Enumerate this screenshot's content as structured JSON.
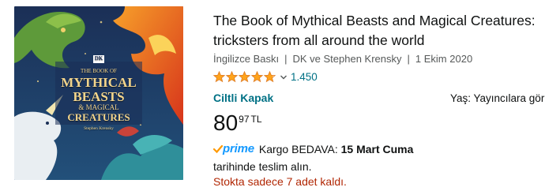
{
  "product": {
    "title_line1": "The Book of Mythical Beasts and Magical Creatures:",
    "title_line2": "tricksters from all around the world",
    "edition": "İngilizce Baskı",
    "authors": "DK ve Stephen Krensky",
    "date": "1 Ekim 2020",
    "rating_stars": 4.8,
    "rating_count": "1.450",
    "format": "Ciltli Kapak",
    "publisher_note": "Yaş: Yayıncılara gör",
    "price_whole": "80",
    "price_fraction": "97",
    "currency": "TL",
    "prime_label": "prime",
    "shipping_prefix": "Kargo BEDAVA:",
    "shipping_date": "15 Mart Cuma",
    "delivery_suffix": "tarihinde teslim alın.",
    "stock_note": "Stokta sadece 7 adet kaldı."
  },
  "cover": {
    "publisher_logo": "DK",
    "line1": "THE BOOK OF",
    "line2": "MYTHICAL",
    "line3": "BEASTS",
    "line4": "& MAGICAL",
    "line5": "CREATURES",
    "byline": "Stephen Krensky"
  },
  "colors": {
    "link": "#007185",
    "price_red": "#b12704",
    "star": "#ffa41c",
    "prime_blue": "#1399ff",
    "cover_bg": "#1f3c66"
  }
}
